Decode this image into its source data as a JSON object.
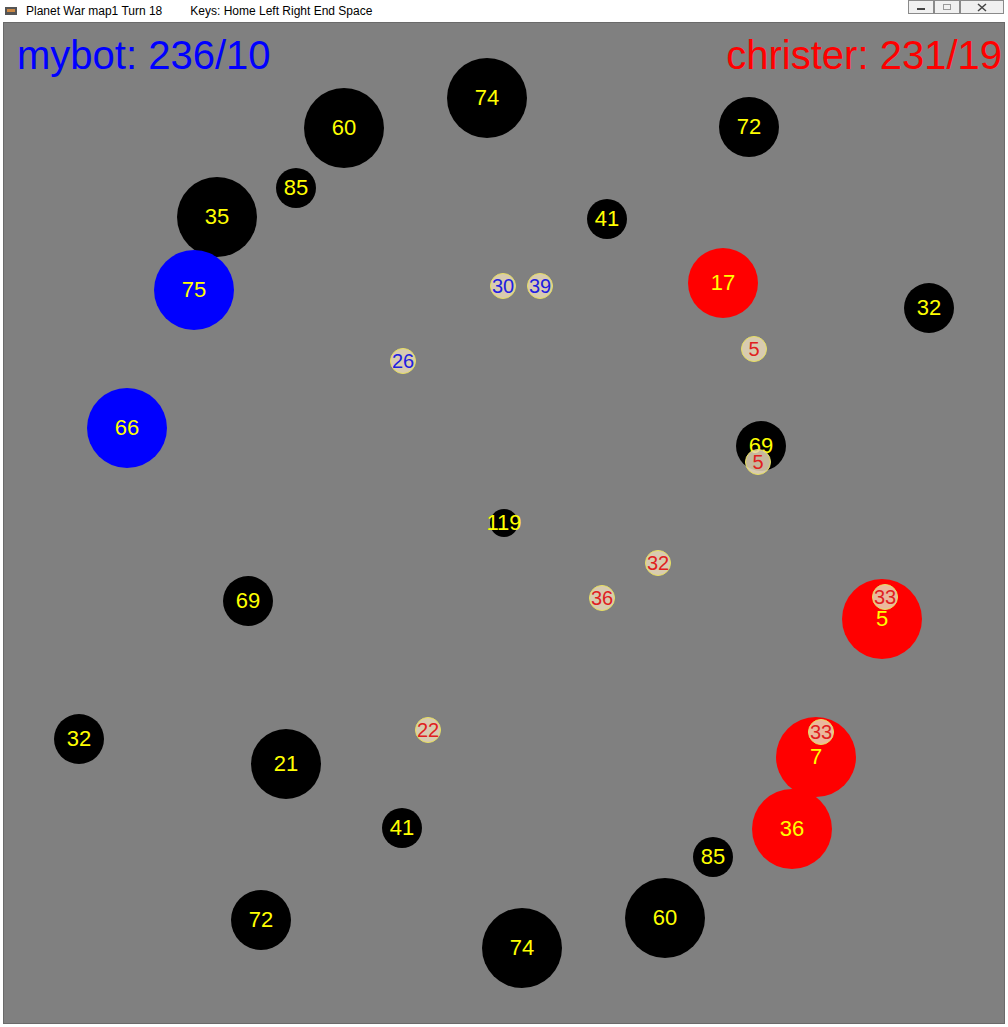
{
  "window": {
    "title": "Planet War map1 Turn 18",
    "keys": "Keys: Home Left Right End Space"
  },
  "scores": [
    {
      "label": "mybot: 236/10",
      "color": "#0000ff"
    },
    {
      "label": "christer: 231/19",
      "color": "#ff0000"
    }
  ],
  "planets": [
    {
      "label": "74",
      "color": "#000000"
    },
    {
      "label": "60",
      "color": "#000000"
    },
    {
      "label": "72",
      "color": "#000000"
    },
    {
      "label": "85",
      "color": "#000000"
    },
    {
      "label": "35",
      "color": "#000000"
    },
    {
      "label": "41",
      "color": "#000000"
    },
    {
      "label": "32",
      "color": "#000000"
    },
    {
      "label": "69",
      "color": "#000000"
    },
    {
      "label": "119",
      "color": "#000000"
    },
    {
      "label": "69",
      "color": "#000000"
    },
    {
      "label": "32",
      "color": "#000000"
    },
    {
      "label": "21",
      "color": "#000000"
    },
    {
      "label": "41",
      "color": "#000000"
    },
    {
      "label": "85",
      "color": "#000000"
    },
    {
      "label": "72",
      "color": "#000000"
    },
    {
      "label": "60",
      "color": "#000000"
    },
    {
      "label": "74",
      "color": "#000000"
    },
    {
      "label": "75",
      "color": "#0000ff"
    },
    {
      "label": "66",
      "color": "#0000ff"
    },
    {
      "label": "17",
      "color": "#ff0000"
    },
    {
      "label": "5",
      "color": "#ff0000"
    },
    {
      "label": "7",
      "color": "#ff0000"
    },
    {
      "label": "36",
      "color": "#ff0000"
    }
  ],
  "fleets": [
    {
      "label": "30",
      "color": "#2020e0"
    },
    {
      "label": "39",
      "color": "#2020e0"
    },
    {
      "label": "26",
      "color": "#2020e0"
    },
    {
      "label": "5",
      "color": "#e02020"
    },
    {
      "label": "5",
      "color": "#e02020"
    },
    {
      "label": "32",
      "color": "#e02020"
    },
    {
      "label": "36",
      "color": "#e02020"
    },
    {
      "label": "33",
      "color": "#e02020"
    },
    {
      "label": "33",
      "color": "#e02020"
    },
    {
      "label": "22",
      "color": "#e02020"
    }
  ]
}
